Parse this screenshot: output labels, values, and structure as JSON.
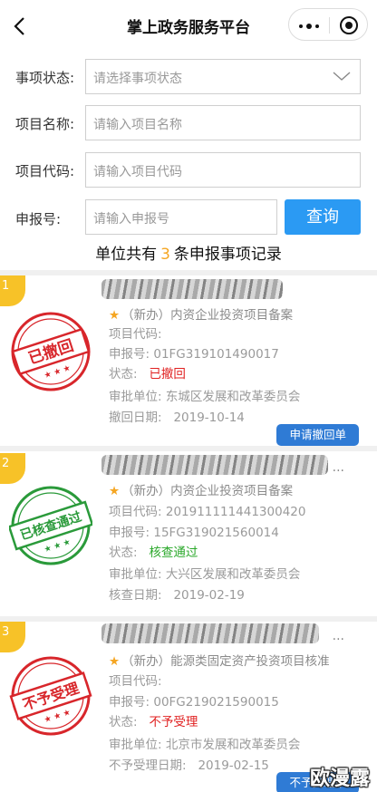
{
  "header": {
    "title": "掌上政务服务平台"
  },
  "form": {
    "status_label": "事项状态:",
    "status_placeholder": "请选择事项状态",
    "name_label": "项目名称:",
    "name_placeholder": "请输入项目名称",
    "code_label": "项目代码:",
    "code_placeholder": "请输入项目代码",
    "report_label": "申报号:",
    "report_placeholder": "请输入申报号",
    "query_button": "查询"
  },
  "summary": {
    "prefix": "单位共有",
    "count": "3",
    "suffix": "条申报事项记录"
  },
  "records": [
    {
      "index": "1",
      "stamp": "已撤回",
      "stamp_color": "#d8262b",
      "type": "（新办）内资企业投资项目备案",
      "code_label": "项目代码:",
      "code_value": "",
      "report_label": "申报号:",
      "report_value": "01FG319101490017",
      "status_label": "状态:",
      "status_value": "已撤回",
      "unit_label": "审批单位:",
      "unit_value": "东城区发展和改革委员会",
      "date_label": "撤回日期:",
      "date_value": "2019-10-14",
      "action": "申请撤回单"
    },
    {
      "index": "2",
      "stamp": "已核查通过",
      "stamp_color": "#2a9a3a",
      "type": "（新办）内资企业投资项目备案",
      "code_label": "项目代码:",
      "code_value": "201911111441300420",
      "report_label": "申报号:",
      "report_value": "15FG319021560014",
      "status_label": "状态:",
      "status_value": "核查通过",
      "unit_label": "审批单位:",
      "unit_value": "大兴区发展和改革委员会",
      "date_label": "核查日期:",
      "date_value": "2019-02-19"
    },
    {
      "index": "3",
      "stamp": "不予受理",
      "stamp_color": "#d8262b",
      "type": "（新办）能源类固定资产投资项目核准",
      "code_label": "项目代码:",
      "code_value": "",
      "report_label": "申报号:",
      "report_value": "00FG219021590015",
      "status_label": "状态:",
      "status_value": "不予受理",
      "unit_label": "审批单位:",
      "unit_value": "北京市发展和改革委员会",
      "date_label": "不予受理日期:",
      "date_value": "2019-02-15",
      "action": "不予受理单"
    }
  ],
  "more": "...",
  "watermark": "欧漫露"
}
